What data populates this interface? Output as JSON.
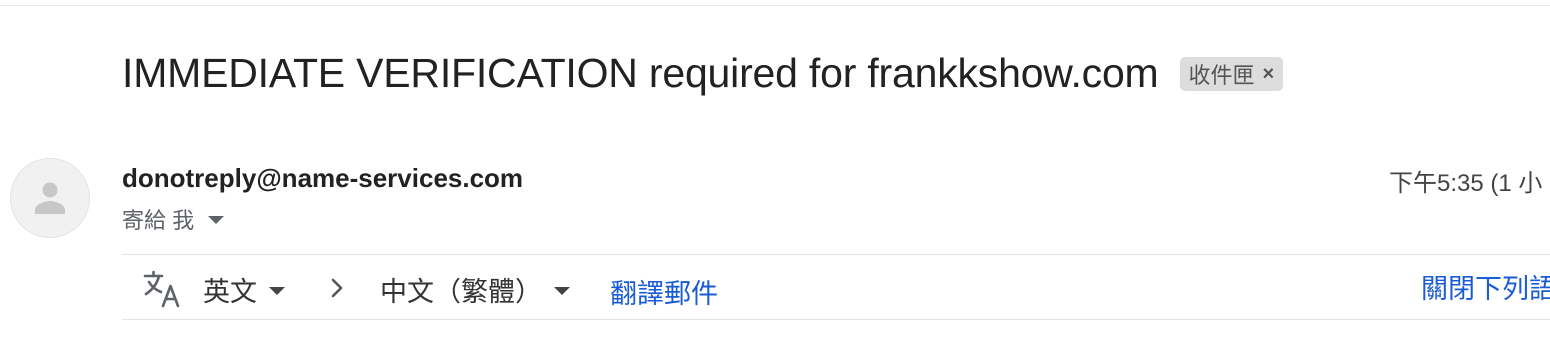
{
  "email": {
    "subject": "IMMEDIATE VERIFICATION required for frankkshow.com",
    "label_chip": "收件匣",
    "label_chip_close": "×",
    "sender": "donotreply@name-services.com",
    "recipient_text": "寄給 我",
    "timestamp": "下午5:35 (1 小"
  },
  "translate_bar": {
    "icon": "translate-icon",
    "source_language": "英文",
    "target_language": "中文（繁體）",
    "translate_link": "翻譯郵件",
    "turn_off_link": "關閉下列語"
  },
  "colors": {
    "link": "#1a5bd6",
    "chip_bg": "#dddddd",
    "avatar_bg": "#f1f1f1"
  }
}
